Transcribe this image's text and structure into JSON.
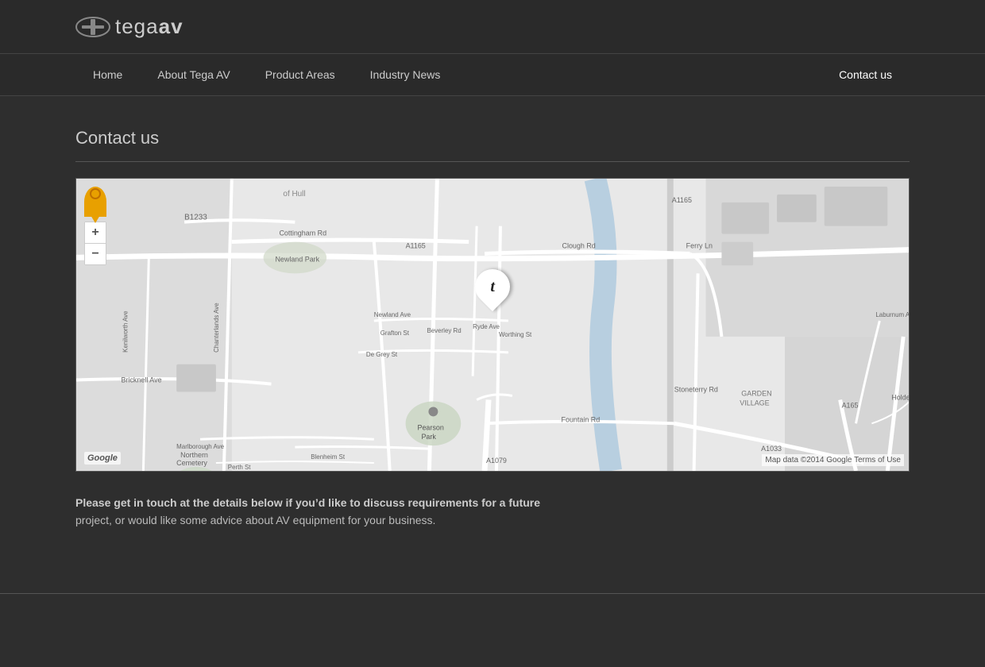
{
  "site": {
    "logo_text": "tega av",
    "logo_text_plain": "tega",
    "logo_text_bold": "av"
  },
  "nav": {
    "items": [
      {
        "id": "home",
        "label": "Home",
        "active": false
      },
      {
        "id": "about",
        "label": "About Tega AV",
        "active": false
      },
      {
        "id": "product-areas",
        "label": "Product Areas",
        "active": false
      },
      {
        "id": "industry-news",
        "label": "Industry News",
        "active": false
      },
      {
        "id": "contact-us",
        "label": "Contact us",
        "active": true
      }
    ]
  },
  "page": {
    "title": "Contact us",
    "description_line1": "Please get in touch at the details below if you’d like to discuss requirements for a future",
    "description_line2": "project, or would like some advice about AV equipment for your business."
  },
  "map": {
    "zoom_plus": "+",
    "zoom_minus": "−",
    "google_label": "Google",
    "attribution": "Map data ©2014 Google   Terms of Use",
    "location_label": "t"
  }
}
